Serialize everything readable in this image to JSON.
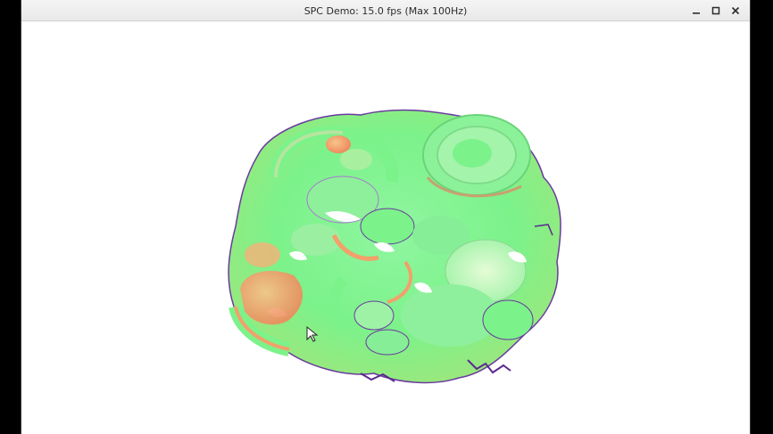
{
  "window": {
    "title": "SPC Demo: 15.0 fps (Max 100Hz)",
    "buttons": {
      "minimize": "–",
      "maximize": "□",
      "close": "×"
    }
  },
  "scene": {
    "description_icon": "volumetric-surface-render",
    "colors": {
      "primary": "#7cf28a",
      "secondary": "#b6f07a",
      "warm": "#f3a06a",
      "edge": "#6a3aa0",
      "highlight": "#d8fbc8"
    }
  }
}
